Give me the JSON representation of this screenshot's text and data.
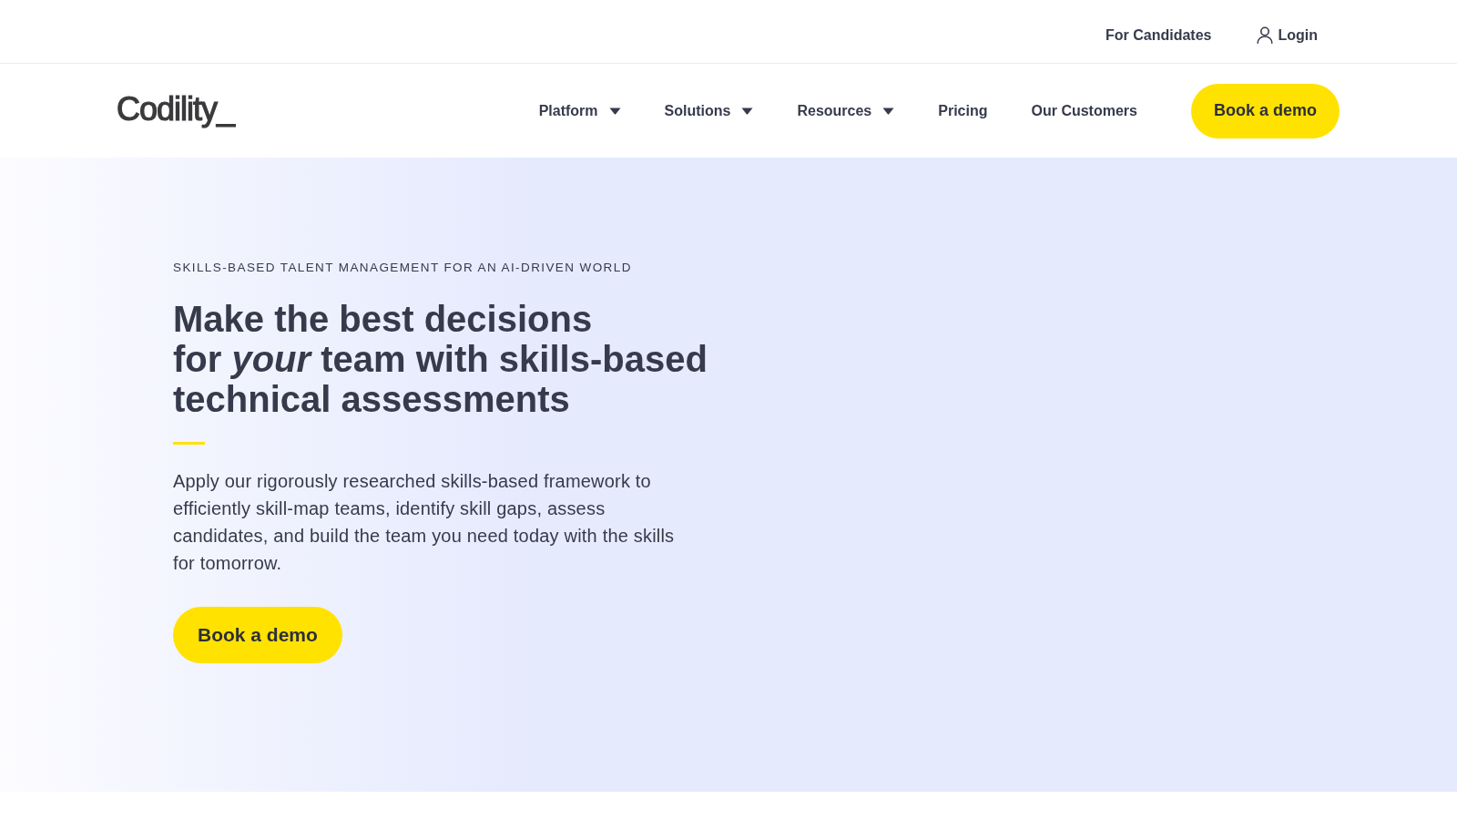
{
  "top_bar": {
    "links": [
      {
        "label": "For Candidates",
        "kind": "plain"
      },
      {
        "label": "Login",
        "kind": "account"
      }
    ]
  },
  "nav": {
    "logo": "Codility_",
    "items": [
      {
        "label": "Platform",
        "has_menu": true
      },
      {
        "label": "Solutions",
        "has_menu": true
      },
      {
        "label": "Resources",
        "has_menu": true
      },
      {
        "label": "Pricing",
        "has_menu": false
      },
      {
        "label": "Our Customers",
        "has_menu": false
      }
    ],
    "cta": "Book a demo"
  },
  "hero": {
    "eyebrow": "SKILLS-BASED TALENT MANAGEMENT FOR AN AI-DRIVEN WORLD",
    "heading_lines": [
      "Make the best decisions",
      "for *your* team with skills-based",
      "technical assessments"
    ],
    "body": "Apply our rigorously researched skills-based framework to efficiently skill-map teams, identify skill gaps, assess candidates, and build the team you need today with the skills for tomorrow.",
    "cta": "Book a demo"
  }
}
